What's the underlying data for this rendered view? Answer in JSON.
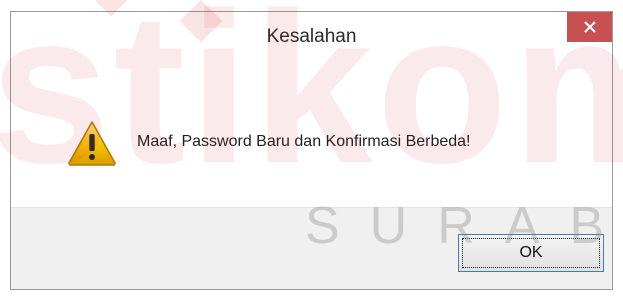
{
  "dialog": {
    "title": "Kesalahan",
    "message": "Maaf, Password Baru dan Konfirmasi Berbeda!",
    "icon": "warning-icon",
    "ok_label": "OK",
    "close_icon": "close-icon"
  },
  "watermark": {
    "word": "stikom",
    "subtitle": "SURABAYA"
  },
  "colors": {
    "close_button": "#c75050",
    "footer": "#f0f0f0",
    "ok_border": "#3c7fb1",
    "warning_yellow": "#f5c400"
  }
}
